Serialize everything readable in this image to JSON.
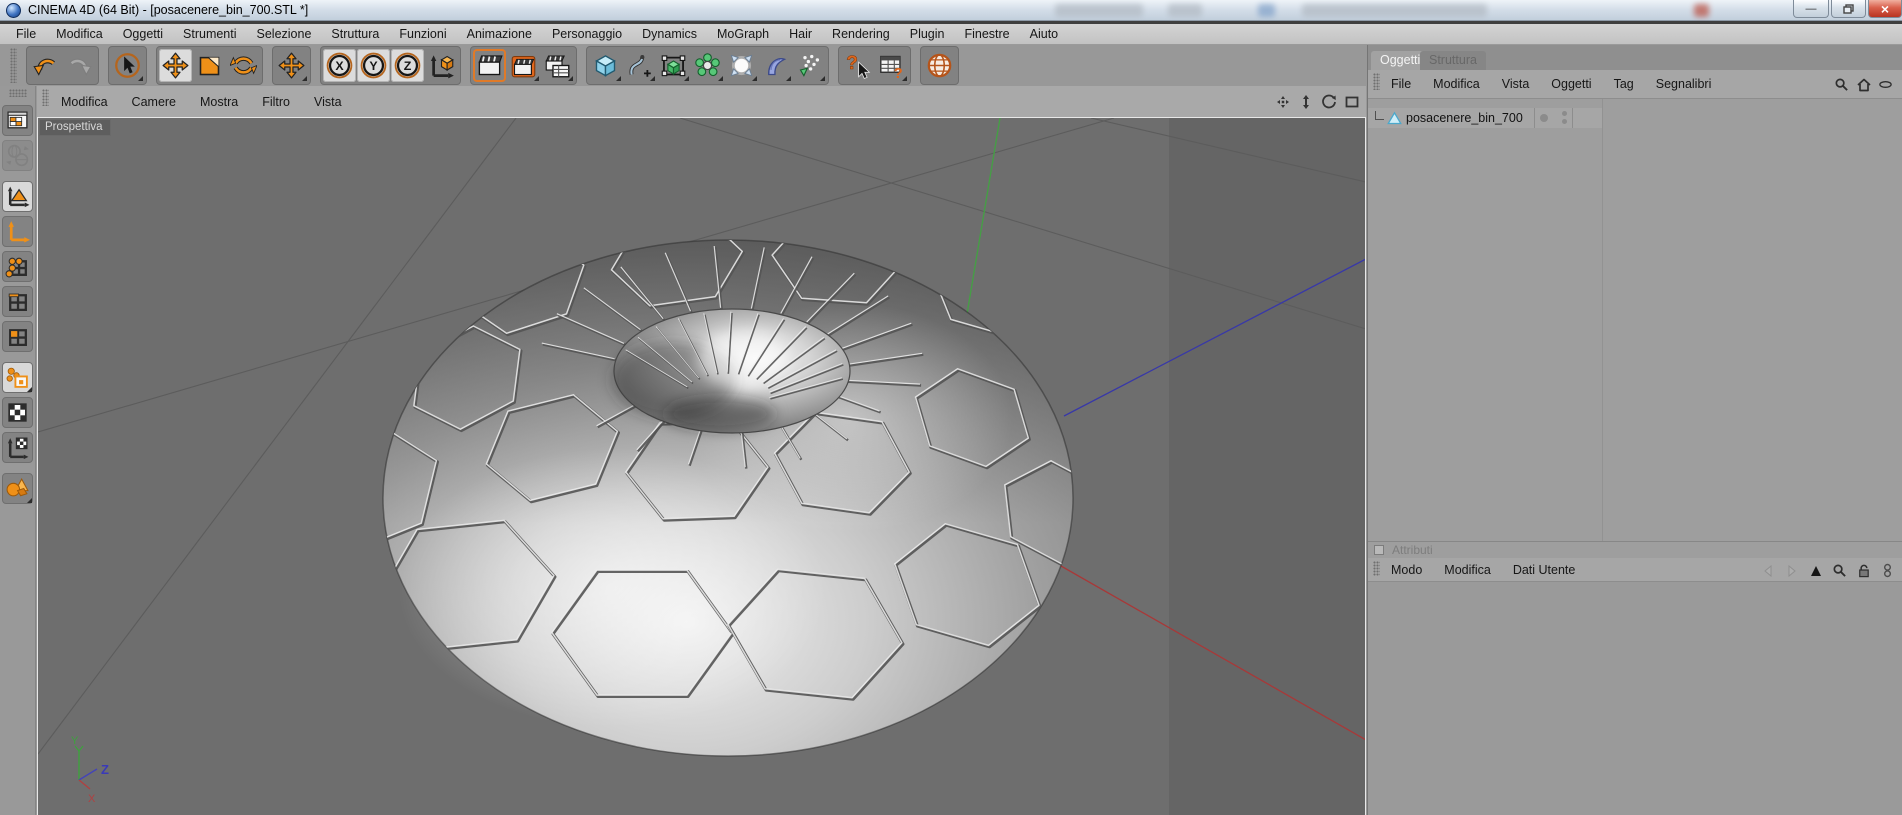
{
  "window": {
    "title": "CINEMA 4D (64 Bit) - [posacenere_bin_700.STL *]",
    "buttons": {
      "minimize": "—",
      "restore": "",
      "close": "×"
    }
  },
  "menubar": {
    "items": [
      "File",
      "Modifica",
      "Oggetti",
      "Strumenti",
      "Selezione",
      "Struttura",
      "Funzioni",
      "Animazione",
      "Personaggio",
      "Dynamics",
      "MoGraph",
      "Hair",
      "Rendering",
      "Plugin",
      "Finestre",
      "Aiuto"
    ]
  },
  "toolbar": {
    "axis_letters": [
      "X",
      "Y",
      "Z"
    ],
    "icons": [
      "undo",
      "redo",
      "live-selection",
      "move",
      "scale",
      "rotate",
      "active-tool-move",
      "axis-x-lock",
      "axis-y-lock",
      "axis-z-lock",
      "coordinate-system",
      "render-view",
      "render-picture-viewer",
      "render-settings",
      "add-primitive-cube",
      "add-spline",
      "add-generator",
      "add-modeling-object",
      "add-light",
      "add-deformer",
      "add-particles",
      "help",
      "content-browser",
      "online-help-globe"
    ]
  },
  "left_palette": {
    "icons": [
      "make-editable",
      "world-coordinates",
      "model-mode",
      "object-axis-mode",
      "point-mode",
      "edge-mode",
      "polygon-mode",
      "texture-uv-mode",
      "texture-mode",
      "texture-axis-mode",
      "display-filter-shapes"
    ]
  },
  "viewport": {
    "menu": [
      "Modifica",
      "Camere",
      "Mostra",
      "Filtro",
      "Vista"
    ],
    "view_label": "Prospettiva",
    "controls": [
      "pan",
      "dolly",
      "rotate",
      "maximize"
    ],
    "axis_gizmo": {
      "x": "X",
      "y": "Y",
      "z": "Z"
    },
    "colors": {
      "background": "#6e6e6e",
      "background_right_strip": "#656565",
      "grid": "#5c5c5c",
      "axis_x": "#a83838",
      "axis_y": "#44a044",
      "axis_z": "#3838a8"
    }
  },
  "object_manager": {
    "tabs": [
      {
        "label": "Oggetti",
        "active": true
      },
      {
        "label": "Struttura",
        "active": false
      }
    ],
    "menu": [
      "File",
      "Modifica",
      "Vista",
      "Oggetti",
      "Tag",
      "Segnalibri"
    ],
    "header_icons": [
      "search",
      "home",
      "filter-eye"
    ],
    "objects": [
      {
        "name": "posacenere_bin_700",
        "type": "polygon-object"
      }
    ]
  },
  "attribute_manager": {
    "panel_title": "Attributi",
    "menu": [
      "Modo",
      "Modifica",
      "Dati Utente"
    ],
    "icons": [
      "history-back",
      "history-forward",
      "collapse-triangle",
      "search",
      "lock",
      "snapshot"
    ]
  },
  "colors": {
    "accent_orange": "#ef9018",
    "ui_gray": "#989898",
    "titlebar_close_red": "#b83421"
  }
}
